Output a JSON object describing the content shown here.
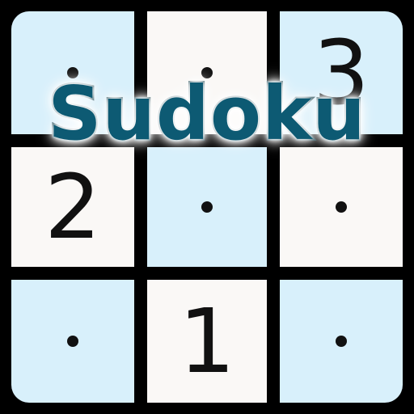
{
  "title": "Sudoku",
  "colors": {
    "light_blue": "#d8f0fb",
    "white": "#faf8f6",
    "title_fill": "#0d5a73",
    "title_outline": "#06323f",
    "grid": "#000000"
  },
  "grid": {
    "rows": 3,
    "cols": 3,
    "cells": [
      {
        "row": 0,
        "col": 0,
        "shade": "light_blue",
        "value": "",
        "dot": true
      },
      {
        "row": 0,
        "col": 1,
        "shade": "white",
        "value": "",
        "dot": true
      },
      {
        "row": 0,
        "col": 2,
        "shade": "light_blue",
        "value": "3",
        "dot": false
      },
      {
        "row": 1,
        "col": 0,
        "shade": "white",
        "value": "2",
        "dot": false
      },
      {
        "row": 1,
        "col": 1,
        "shade": "light_blue",
        "value": "",
        "dot": true
      },
      {
        "row": 1,
        "col": 2,
        "shade": "white",
        "value": "",
        "dot": true
      },
      {
        "row": 2,
        "col": 0,
        "shade": "light_blue",
        "value": "",
        "dot": true
      },
      {
        "row": 2,
        "col": 1,
        "shade": "white",
        "value": "1",
        "dot": false
      },
      {
        "row": 2,
        "col": 2,
        "shade": "light_blue",
        "value": "",
        "dot": true
      }
    ]
  }
}
